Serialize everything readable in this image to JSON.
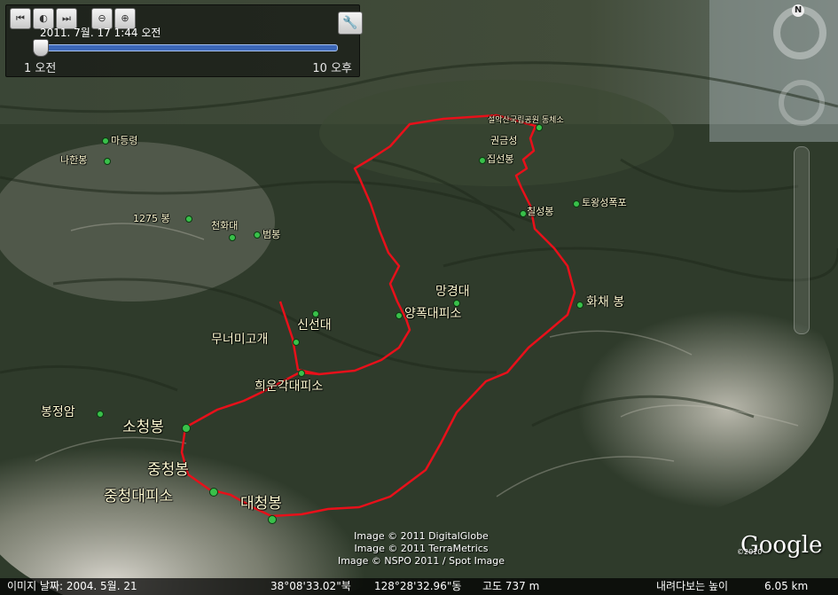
{
  "timebar": {
    "date_label": "2011. 7월. 17   1:44 오전",
    "left_label": "1 오전",
    "right_label": "10 오후",
    "slider_position": 0.04
  },
  "labels": [
    {
      "id": "madeungryeong",
      "text": "마등령"
    },
    {
      "id": "nahanbong",
      "text": "나한봉"
    },
    {
      "id": "b1275",
      "text": "1275 봉"
    },
    {
      "id": "cheonhwadae",
      "text": "천화대"
    },
    {
      "id": "beombong",
      "text": "범봉"
    },
    {
      "id": "seoraksan-office",
      "text": "설악산국립공원 동체소"
    },
    {
      "id": "gwongeumseong",
      "text": "권금성"
    },
    {
      "id": "jipseonbong",
      "text": "집선봉"
    },
    {
      "id": "chilseongbong",
      "text": "칠성봉"
    },
    {
      "id": "towangseong",
      "text": "토왕성폭포"
    },
    {
      "id": "manggyeongdae",
      "text": "망경대"
    },
    {
      "id": "yangpok",
      "text": "양폭대피소"
    },
    {
      "id": "hwachaebong",
      "text": "화채 봉"
    },
    {
      "id": "sinseondae",
      "text": "신선대"
    },
    {
      "id": "muneomigogae",
      "text": "무너미고개"
    },
    {
      "id": "huiungak",
      "text": "희운각대피소"
    },
    {
      "id": "bongjeongam",
      "text": "봉정암"
    },
    {
      "id": "socheongbong",
      "text": "소청봉"
    },
    {
      "id": "jungcheongbong",
      "text": "중청봉"
    },
    {
      "id": "jungcheong-shelter",
      "text": "중청대피소"
    },
    {
      "id": "daecheongbong",
      "text": "대청봉"
    }
  ],
  "credits": [
    "Image © 2011 DigitalGlobe",
    "Image © 2011 TerraMetrics",
    "Image © NSPO 2011 / Spot Image"
  ],
  "brand": {
    "name": "Google",
    "year": "©2010"
  },
  "status": {
    "image_date": "이미지 날짜: 2004. 5월. 21",
    "latitude": "38°08'33.02\"북",
    "longitude": "128°28'32.96\"동",
    "altitude": "고도  737 m",
    "eye_label": "내려다보는 높이",
    "eye_value": "6.05 km"
  },
  "route_color": "#e8101a",
  "marker_color": "#39c04a"
}
